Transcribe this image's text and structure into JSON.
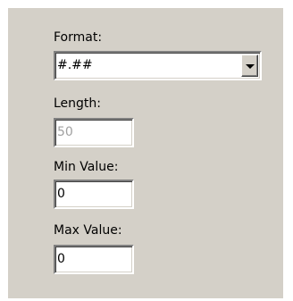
{
  "form": {
    "format": {
      "label": "Format:",
      "value": "#.##",
      "icon": "chevron-down-icon"
    },
    "length": {
      "label": "Length:",
      "value": "50",
      "disabled": true
    },
    "min_value": {
      "label": "Min Value:",
      "value": "0"
    },
    "max_value": {
      "label": "Max Value:",
      "value": "0"
    }
  }
}
